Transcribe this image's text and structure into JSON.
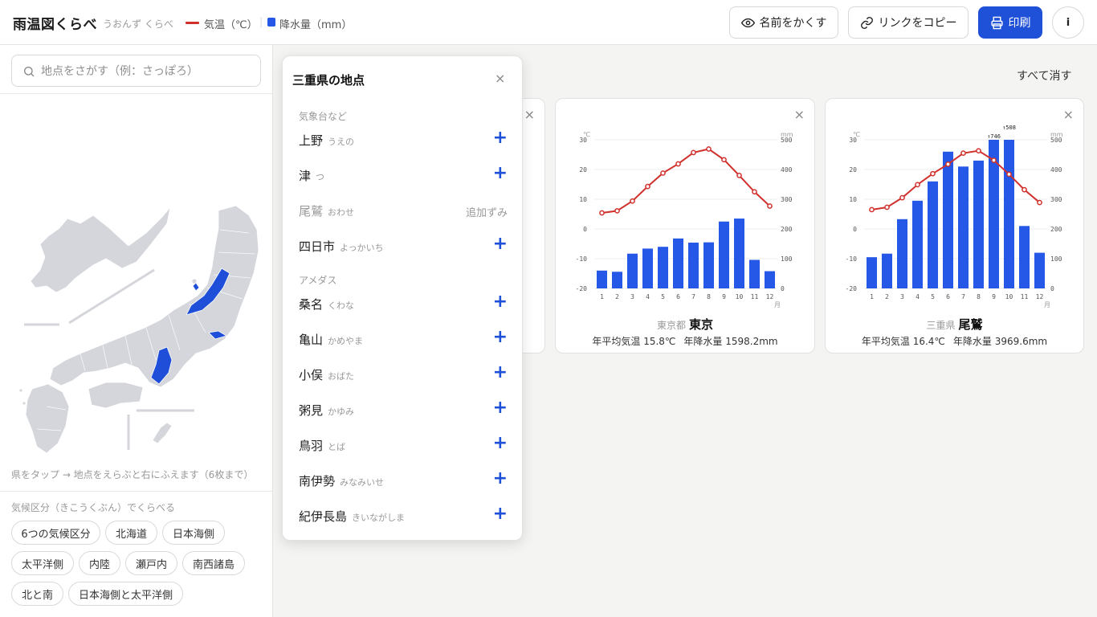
{
  "header": {
    "title": "雨温図くらべ",
    "reading": "うおんず くらべ",
    "legend_temp": "気温（℃）",
    "legend_rain": "降水量（mm）",
    "hide_names": "名前をかくす",
    "copy_link": "リンクをコピー",
    "print": "印刷",
    "info": "i",
    "eye_icon": "eye-icon",
    "link_icon": "link-icon",
    "printer_icon": "printer-icon"
  },
  "sidebar": {
    "search_placeholder": "地点をさがす（例：さっぽろ）",
    "map_hint": "県をタップ → 地点をえらぶと右にふえます（6枚まで）",
    "region_title": "気候区分（きこうくぶん）でくらべる",
    "chips": [
      "6つの気候区分",
      "北海道",
      "日本海側",
      "太平洋側",
      "内陸",
      "瀬戸内",
      "南西諸島",
      "北と南",
      "日本海側と太平洋側"
    ],
    "highlight_color": "#1f4fd8"
  },
  "main": {
    "clear_all": "すべて消す"
  },
  "popup": {
    "title": "三重県の地点",
    "close": "×",
    "sections": [
      "気象台など",
      "アメダス"
    ],
    "added_label": "追加ずみ",
    "add_symbol": "+",
    "items": [
      {
        "name": "上野",
        "reading": "うえの",
        "added": false
      },
      {
        "name": "津",
        "reading": "つ",
        "added": false
      },
      {
        "name": "尾鷲",
        "reading": "おわせ",
        "added": true
      },
      {
        "name": "四日市",
        "reading": "よっかいち",
        "added": false
      },
      {
        "name": "桑名",
        "reading": "くわな",
        "added": false
      },
      {
        "name": "亀山",
        "reading": "かめやま",
        "added": false
      },
      {
        "name": "小俣",
        "reading": "おばた",
        "added": false
      },
      {
        "name": "粥見",
        "reading": "かゆみ",
        "added": false
      },
      {
        "name": "鳥羽",
        "reading": "とば",
        "added": false
      },
      {
        "name": "南伊勢",
        "reading": "みなみいせ",
        "added": false
      },
      {
        "name": "紀伊長島",
        "reading": "きいながしま",
        "added": false
      }
    ]
  },
  "cards": [
    {
      "pref": "東京都",
      "name": "東京",
      "avg_temp_text": "年平均気温 15.8℃",
      "rain_text": "年降水量 1598.2mm",
      "close": "×"
    },
    {
      "pref": "三重県",
      "name": "尾鷲",
      "avg_temp_text": "年平均気温 16.4℃",
      "rain_text": "年降水量 3969.6mm",
      "close": "×"
    }
  ],
  "chart_data": [
    {
      "type": "bar",
      "title": "東京",
      "categories": [
        "1",
        "2",
        "3",
        "4",
        "5",
        "6",
        "7",
        "8",
        "9",
        "10",
        "11",
        "12"
      ],
      "xunit": "月",
      "left_unit": "℃",
      "right_unit": "mm",
      "temp_ticks": [
        30,
        20,
        10,
        0,
        -10,
        -20
      ],
      "rain_ticks": [
        500,
        400,
        300,
        200,
        100,
        0
      ],
      "ylim_temp": [
        -20,
        30
      ],
      "ylim_rain": [
        0,
        500
      ],
      "series": [
        {
          "name": "降水量",
          "kind": "bar",
          "color": "#2558e6",
          "values": [
            60,
            56,
            117,
            134,
            140,
            168,
            154,
            155,
            225,
            235,
            96,
            58
          ]
        },
        {
          "name": "気温",
          "kind": "line",
          "color": "#d0312d",
          "values": [
            5.4,
            6.1,
            9.4,
            14.3,
            18.8,
            21.9,
            25.7,
            26.9,
            23.3,
            18.0,
            12.5,
            7.7
          ]
        }
      ],
      "overflow_labels": []
    },
    {
      "type": "bar",
      "title": "尾鷲",
      "categories": [
        "1",
        "2",
        "3",
        "4",
        "5",
        "6",
        "7",
        "8",
        "9",
        "10",
        "11",
        "12"
      ],
      "xunit": "月",
      "left_unit": "℃",
      "right_unit": "mm",
      "temp_ticks": [
        30,
        20,
        10,
        0,
        -10,
        -20
      ],
      "rain_ticks": [
        500,
        400,
        300,
        200,
        100,
        0
      ],
      "ylim_temp": [
        -20,
        30
      ],
      "ylim_rain": [
        0,
        500
      ],
      "series": [
        {
          "name": "降水量",
          "kind": "bar",
          "color": "#2558e6",
          "values": [
            105,
            117,
            233,
            295,
            360,
            460,
            410,
            430,
            746,
            508,
            210,
            120
          ]
        },
        {
          "name": "気温",
          "kind": "line",
          "color": "#d0312d",
          "values": [
            6.5,
            7.3,
            10.5,
            14.9,
            18.6,
            21.8,
            25.5,
            26.3,
            23.1,
            18.4,
            13.2,
            8.9
          ]
        }
      ],
      "overflow_labels": [
        {
          "month": "9",
          "text": "↑746"
        },
        {
          "month": "10",
          "text": "↑508"
        }
      ]
    }
  ]
}
